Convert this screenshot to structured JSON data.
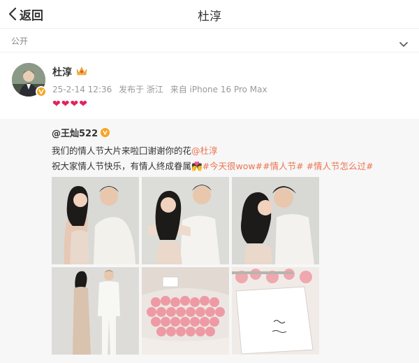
{
  "header": {
    "back_label": "返回",
    "title": "杜淳"
  },
  "visibility": {
    "label": "公开"
  },
  "post": {
    "author": "杜淳",
    "date": "25-2-14 12:36",
    "location": "发布于 浙江",
    "device": "来自 iPhone 16 Pro Max",
    "content": "❤❤❤❤"
  },
  "repost": {
    "author": "@王灿522",
    "line1_text": "我们的情人节大片来啦囗谢谢你的花",
    "line1_mention": "@杜淳",
    "line2_text": "祝大家情人节快乐，有情人终成眷属💏",
    "tags": [
      "#今天很wow#",
      "#情人节#",
      "#情人节怎么过#"
    ]
  },
  "photos": [
    "photo-1",
    "photo-2",
    "photo-3",
    "photo-4",
    "photo-5",
    "photo-6"
  ],
  "colors": {
    "accent": "#eb7350",
    "verified": "#f5a623",
    "heart": "#e0245e"
  }
}
